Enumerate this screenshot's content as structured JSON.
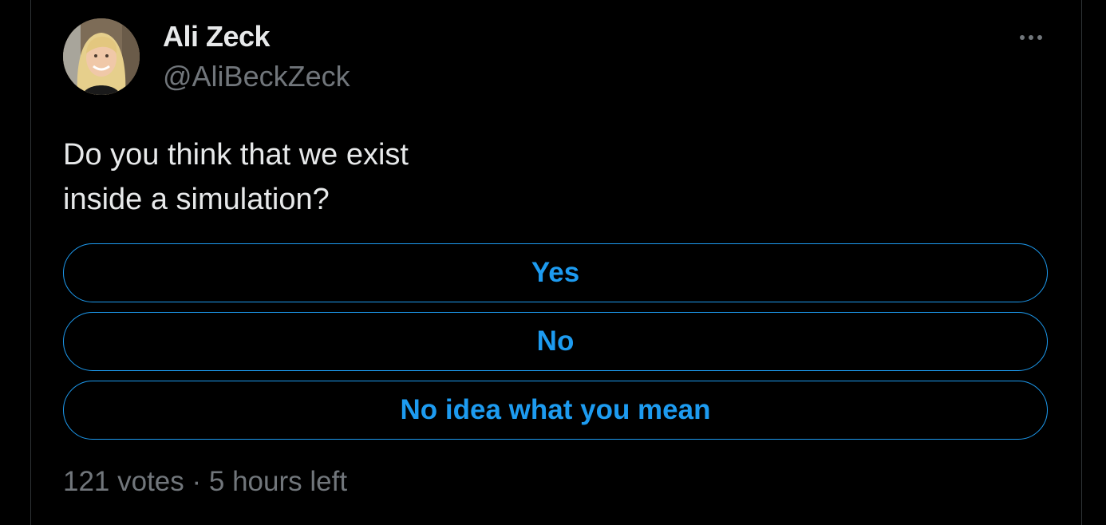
{
  "author": {
    "display_name": "Ali Zeck",
    "handle": "@AliBeckZeck"
  },
  "more_icon": "more-horizontal-icon",
  "tweet": {
    "lines": [
      "Do you think that we exist",
      "inside a simulation?"
    ]
  },
  "poll": {
    "options": [
      {
        "label": "Yes"
      },
      {
        "label": "No"
      },
      {
        "label": "No idea what you mean"
      }
    ],
    "votes": "121 votes",
    "separator": "·",
    "time_left": "5 hours left"
  },
  "colors": {
    "background": "#000000",
    "accent": "#1d9bf0",
    "primary_text": "#e7e9ea",
    "secondary_text": "#71767b"
  }
}
